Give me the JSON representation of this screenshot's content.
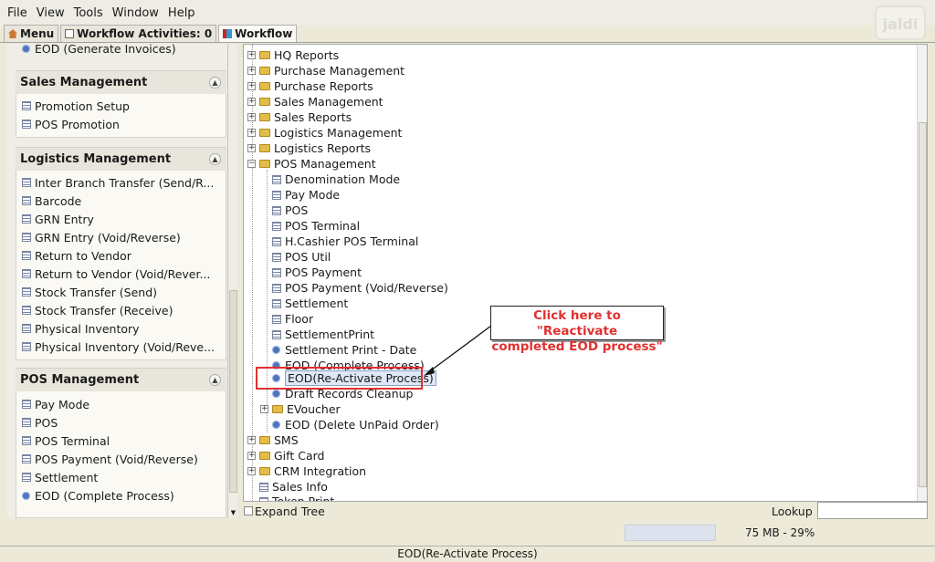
{
  "menubar": {
    "items": [
      "File",
      "View",
      "Tools",
      "Window",
      "Help"
    ]
  },
  "logo": "jaldi",
  "tabs": [
    {
      "label": "Menu"
    },
    {
      "label": "Workflow Activities: 0"
    },
    {
      "label": "Workflow"
    }
  ],
  "left_panel": {
    "top_item": "EOD (Generate Invoices)",
    "sales": {
      "title": "Sales Management",
      "items": [
        "Promotion Setup",
        "POS Promotion"
      ]
    },
    "logistics": {
      "title": "Logistics Management",
      "items": [
        "Inter Branch Transfer (Send/R...",
        "Barcode",
        "GRN Entry",
        "GRN Entry (Void/Reverse)",
        "Return to Vendor",
        "Return to Vendor (Void/Rever...",
        "Stock Transfer (Send)",
        "Stock Transfer (Receive)",
        "Physical Inventory",
        "Physical Inventory (Void/Reve..."
      ]
    },
    "pos": {
      "title": "POS Management",
      "items": [
        "Pay Mode",
        "POS",
        "POS Terminal",
        "POS Payment (Void/Reverse)",
        "Settlement",
        "EOD (Complete Process)"
      ]
    }
  },
  "tree": {
    "top": [
      "HQ Reports",
      "Purchase Management",
      "Purchase Reports",
      "Sales Management",
      "Sales Reports",
      "Logistics Management",
      "Logistics Reports"
    ],
    "pos_folder": "POS Management",
    "pos_children": [
      "Denomination Mode",
      "Pay Mode",
      "POS",
      "POS Terminal",
      "H.Cashier POS Terminal",
      "POS Util",
      "POS Payment",
      "POS Payment (Void/Reverse)",
      "Settlement",
      "Floor",
      "SettlementPrint",
      "Settlement Print - Date",
      "EOD (Complete Process)",
      "EOD(Re-Activate Process)",
      "Draft Records Cleanup",
      "EVoucher",
      "EOD (Delete UnPaid Order)"
    ],
    "bottom": [
      "SMS",
      "Gift Card",
      "CRM Integration",
      "Sales Info",
      "Token Print"
    ]
  },
  "callout": {
    "line1": "Click here to \"Reactivate",
    "line2": "completed EOD process\""
  },
  "expand_tree": "Expand Tree",
  "lookup": {
    "label": "Lookup",
    "value": ""
  },
  "memory": {
    "text": "75 MB - 29%",
    "percent": 29
  },
  "footer": "EOD(Re-Activate Process)"
}
